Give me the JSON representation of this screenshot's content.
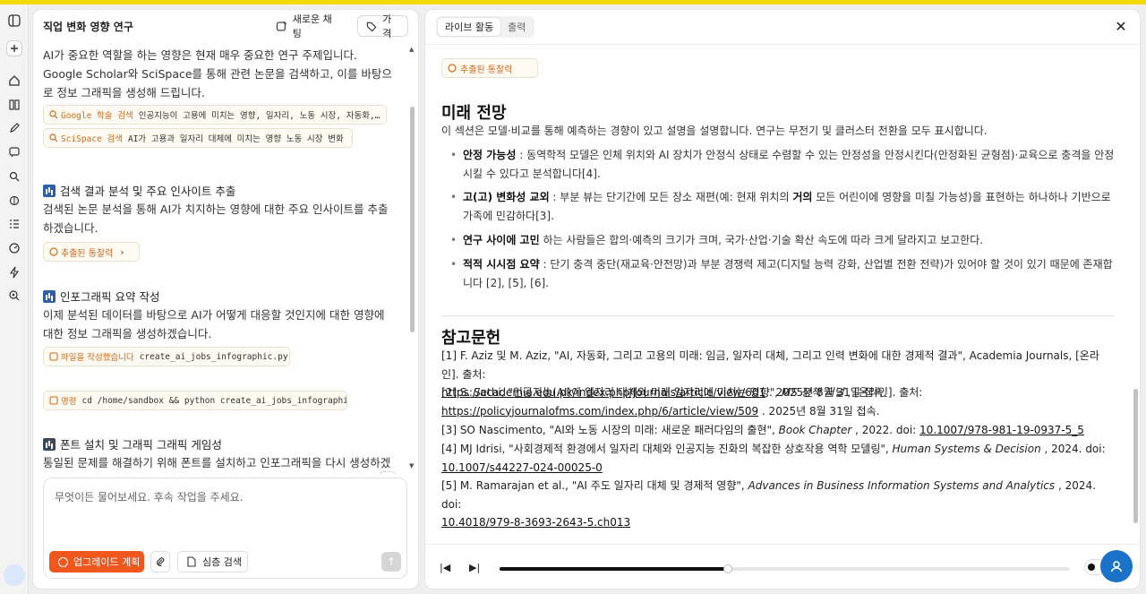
{
  "chat": {
    "title": "직업 변화 영향 연구",
    "new_chat_label": "새로운 채팅",
    "price_label": "가격",
    "intro": "AI가 중요한 역할을 하는 영향은 현재 매우 중요한 연구 주제입니다. Google Scholar와 SciSpace를 통해 관련 논문을 검색하고, 이를 바탕으로 정보 그래픽을 생성해 드립니다.",
    "google_tag": "Google 학술 검색",
    "google_query": "인공지능이 고용에 미치는 영향, 일자리, 노동 시장, 자동화,…",
    "scispace_tag": "SciSpace 검색",
    "scispace_query": "AI가 고용과 일자리 대체에 미치는 영향 노동 시장 변화",
    "step1_title": "검색 결과 분석 및 주요 인사이트 추출",
    "step1_text": "검색된 논문 분석을 통해 AI가 치지하는 영향에 대한 주요 인사이트를 추출하겠습니다.",
    "insight_chip": "추출된 통찰력",
    "step2_title": "인포그래픽 요약 작성",
    "step2_text": "이제 분석된 데이터를 바탕으로 AI가 어떻게 대응할 것인지에 대한 영향에 대한 정보 그래픽을 생성하겠습니다.",
    "file_tag": "파일을 작성했습니다",
    "file_name": "create_ai_jobs_infographic.py",
    "cmd_tag": "명령",
    "cmd_text": "cd /home/sandbox && python create_ai_jobs_infographic.py",
    "step3_title": "폰트 설치 및 그래픽 그래픽 게임성",
    "step3_text": "통일된 문제를 해결하기 위해 폰트를 설치하고 인포그래픽을 다시 생성하겠습니다.",
    "composer_placeholder": "무엇이든 물어보세요. 후속 작업을 주세요.",
    "upgrade_label": "업그레이드 계획",
    "deep_search_label": "심층 검색"
  },
  "doc": {
    "tab_live": "라이브 활동",
    "tab_output": "출력",
    "insight_chip": "추출된 통찰력",
    "future_heading": "미래 전망",
    "future_intro": "이 섹션은 모델·비교를 통해 예측하는 경향이 있고 설명을 설명합니다. 연구는 무전기 및 클러스터 전환을 모두 표시합니다.",
    "bullets": [
      {
        "bold": "안정 가능성",
        "text": " : 동역학적 모델은 인체 위치와 AI 장치가 안정식 상태로 수렴할 수 있는 안정성을 안정시킨다(안정화된 균형점)·교육으로 충격을 안정시킬 수 있다고 분석합니다[4]."
      },
      {
        "bold": "고(고) 변화성 교외",
        "text": " : 부분 뷰는 단기간에 모든 장소 재편(예: 현재 위치의 ",
        "bold2": "거의",
        "text2": " 모든 어린이에 영향을 미칠 가능성)을 표현하는 하나하나 기반으로 가족에 민감하다[3]."
      },
      {
        "bold": "연구 사이에 고민",
        "text": " 하는 사람들은 합의·예측의 크기가 크며, 국가·산업·기술 확산 속도에 따라 크게 달라지고 보고한다."
      },
      {
        "bold": "적적 시시점 요약",
        "text": " : 단기 충격 중단(재교육·안전망)과 부분 경쟁력 제고(디지털 능력 강화, 산업별 전환 전략)가 있어야 할 것이 있기 때문에 존재합니다 [2], [5], [6]."
      }
    ],
    "refs_heading": "참고문헌",
    "refs": {
      "r1a": "[1] F. Aziz 및 M. Aziz, \"AI, 자동화, 그리고 고용의 미래: 임금, 일자리 대체, 그리고 인력 변화에 대한 경제적 결과\", Academia Journals, [온라인]. 출처:",
      "r1link": "https://academia.edu.pk/index.php/Journals/article/view/601",
      "r1b": " . 2025년 8월 31일 접속.",
      "r2a": "[2] S. Sethi, \"인공지능(AI)이 일자리 대체와 미래 일자리에 미치는 영향\", ",
      "r2i": "MS 정책 저널",
      "r2b": " , [온라인]. 출처:",
      "r2link": "https://policyjournalofms.com/index.php/6/article/view/509",
      "r2c": " . 2025년 8월 31일 접속.",
      "r3a": "[3] SO Nascimento, \"AI와 노동 시장의 미래: 새로운 패러다임의 출현\", ",
      "r3i": "Book Chapter",
      "r3b": " , 2022. doi: ",
      "r3link": "10.1007/978-981-19-0937-5_5",
      "r4a": "[4] MJ Idrisi, \"사회경제적 환경에서 일자리 대체와 인공지능 진화의 복잡한 상호작용 역학 모델링\", ",
      "r4i": "Human Systems & Decision",
      "r4b": " , 2024. doi:",
      "r4link": "10.1007/s44227-024-00025-0",
      "r5a": "[5] M. Ramarajan et al., \"AI 주도 일자리 대체 및 경제적 영향\", ",
      "r5i": "Advances in Business Information Systems and Analytics",
      "r5b": " , 2024. doi:",
      "r5link": "10.4018/979-8-3693-2643-5.ch013"
    },
    "playback_progress": 0.4
  }
}
